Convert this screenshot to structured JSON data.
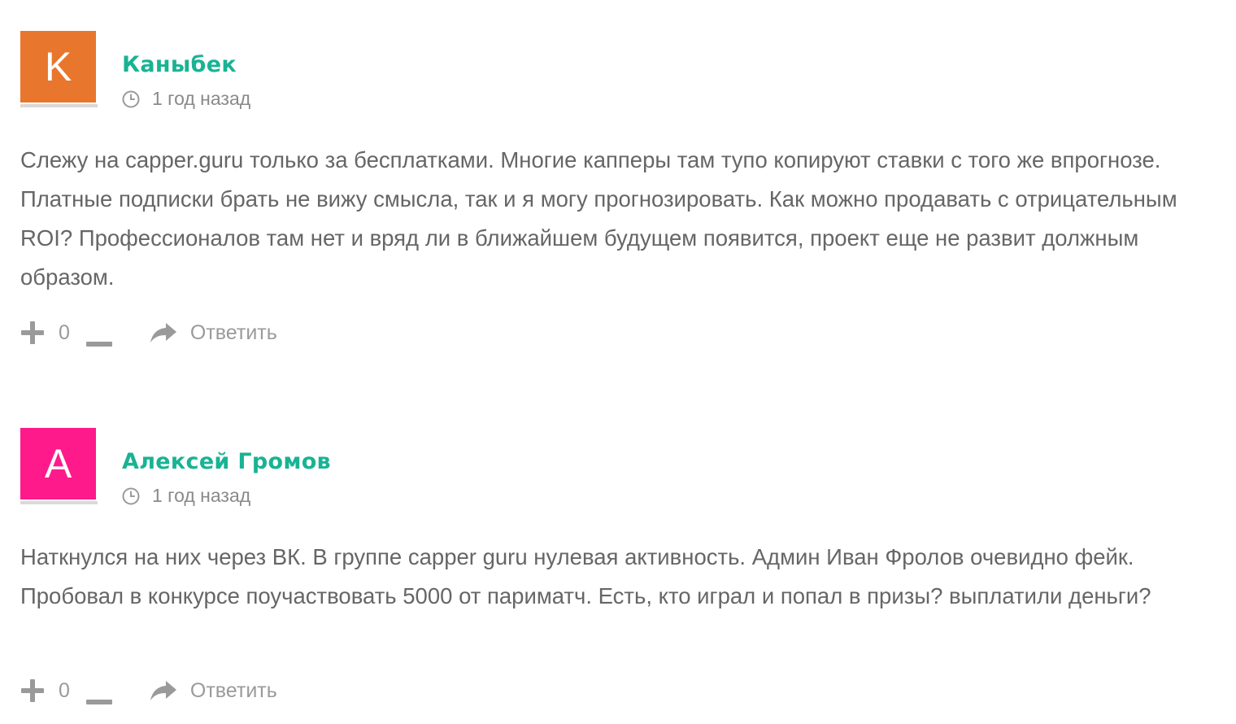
{
  "comments": [
    {
      "avatar_letter": "K",
      "avatar_color": "#e8762c",
      "author": "Каныбек",
      "time": "1 год назад",
      "text": "Слежу на capper.guru только за бесплатками. Многие капперы там тупо копируют ставки с того же впрогнозе. Платные подписки брать не вижу смысла, так и я могу прогнозировать. Как можно продавать с отрицательным ROI? Профессионалов там нет и вряд ли в ближайшем будущем появится, проект еще не развит должным образом.",
      "votes": "0",
      "reply_label": "Ответить"
    },
    {
      "avatar_letter": "A",
      "avatar_color": "#ff1a8c",
      "author": "Алексей Громов",
      "time": "1 год назад",
      "text": "Наткнулся на них через ВК. В группе capper guru нулевая активность. Админ Иван Фролов очевидно фейк. Пробовал в конкурсе поучаствовать 5000 от париматч. Есть, кто играл и попал в призы? выплатили деньги?",
      "votes": "0",
      "reply_label": "Ответить"
    }
  ],
  "colors": {
    "author_name": "#19b394",
    "body_text": "#666666",
    "meta_text": "#8a8a8a",
    "action_icons": "#9a9a9a"
  },
  "icons": {
    "time": "clock-icon",
    "upvote": "plus-icon",
    "downvote": "minus-icon",
    "reply": "reply-arrow-icon"
  }
}
